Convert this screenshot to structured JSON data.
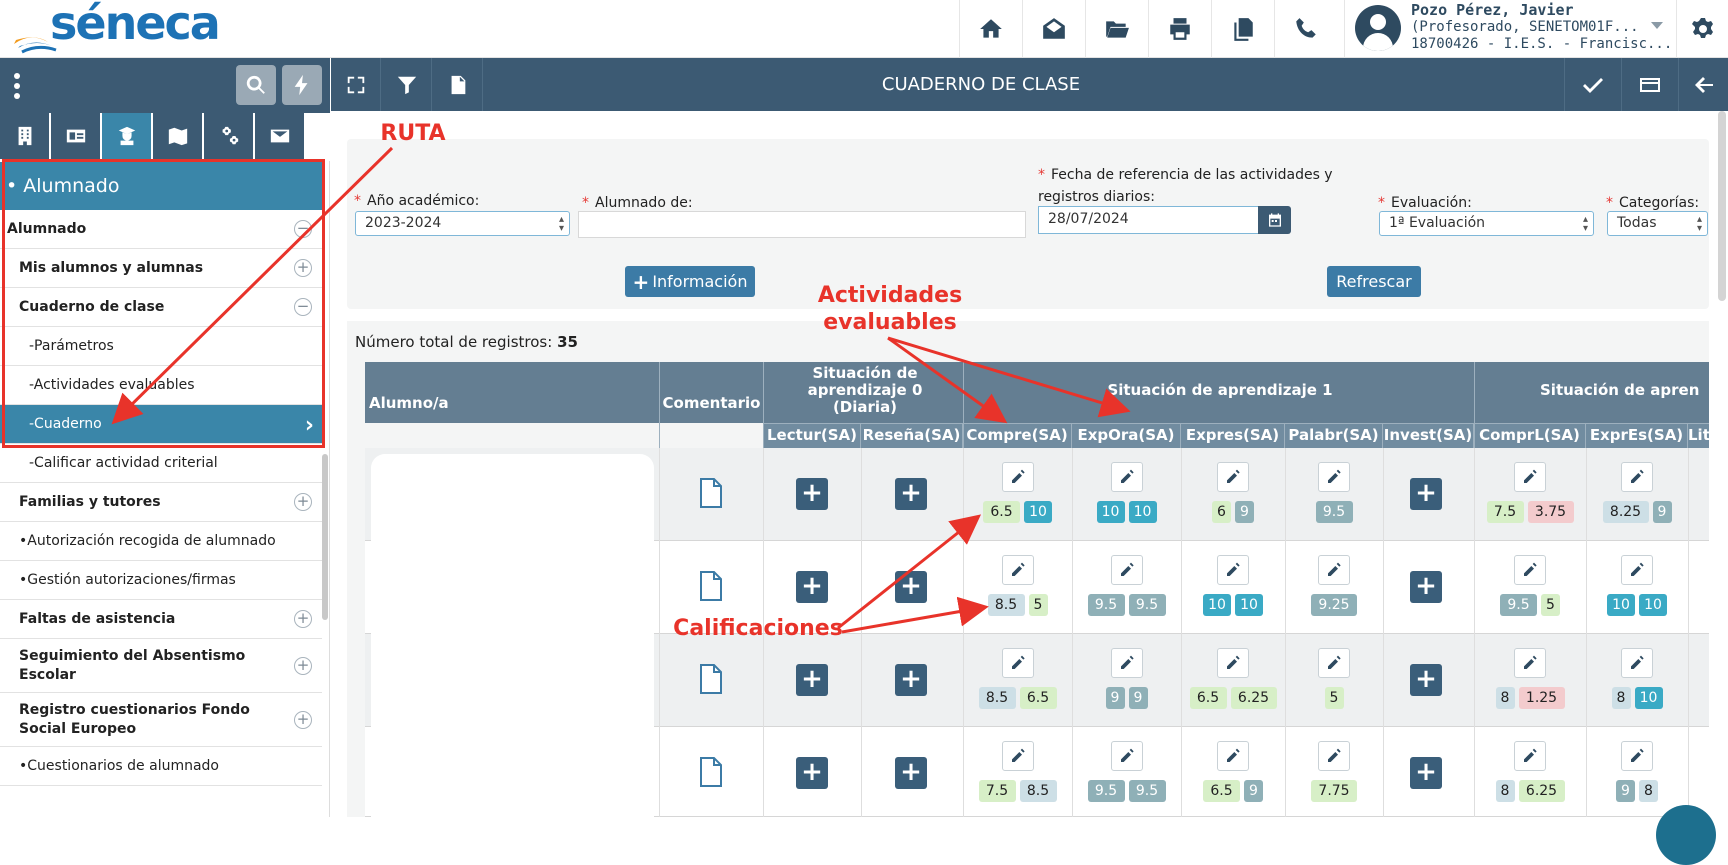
{
  "app": {
    "logo_text": "séneca"
  },
  "topbar": {
    "icons": [
      "home-icon",
      "mail-icon",
      "folder-icon",
      "print-icon",
      "documents-icon",
      "phone-icon"
    ],
    "user": {
      "name": "Pozo Pérez, Javier",
      "role": "(Profesorado, SENETOM01F...",
      "center": "18700426 - I.E.S. - Francisc..."
    }
  },
  "sidebar": {
    "header": "• Alumnado",
    "items": [
      {
        "label": "Alumnado",
        "level": 0,
        "bold": true,
        "control": "−"
      },
      {
        "label": "Mis alumnos y alumnas",
        "level": 1,
        "bold": true,
        "control": "+"
      },
      {
        "label": "Cuaderno de clase",
        "level": 1,
        "bold": true,
        "control": "−"
      },
      {
        "label": "-Parámetros",
        "level": 2
      },
      {
        "label": "-Actividades evaluables",
        "level": 2
      },
      {
        "label": "-Cuaderno",
        "level": 2,
        "selected": true
      },
      {
        "label": "-Calificar actividad criterial",
        "level": 2
      },
      {
        "label": "Familias y tutores",
        "level": 1,
        "bold": true,
        "control": "+"
      },
      {
        "label": "•Autorización recogida de alumnado",
        "level": 1
      },
      {
        "label": "•Gestión autorizaciones/firmas",
        "level": 1
      },
      {
        "label": "Faltas de asistencia",
        "level": 1,
        "bold": true,
        "control": "+"
      },
      {
        "label": "Seguimiento del Absentismo Escolar",
        "level": 1,
        "bold": true,
        "control": "+",
        "tall": true
      },
      {
        "label": "Registro cuestionarios Fondo Social Europeo",
        "level": 1,
        "bold": true,
        "control": "+",
        "tall": true
      },
      {
        "label": "•Cuestionarios de alumnado",
        "level": 1
      }
    ]
  },
  "main": {
    "title": "CUADERNO DE CLASE",
    "form": {
      "anio_label": "Año académico:",
      "anio_value": "2023-2024",
      "alumnado_label": "Alumnado de:",
      "alumnado_value": "",
      "fecha_label_1": "Fecha de referencia de las actividades y",
      "fecha_label_2": "registros diarios:",
      "fecha_value": "28/07/2024",
      "evaluacion_label": "Evaluación:",
      "evaluacion_value": "1ª Evaluación",
      "categorias_label": "Categorías:",
      "categorias_value": "Todas",
      "info_button": "Información",
      "refresh_button": "Refrescar"
    },
    "total_label": "Número total de registros:",
    "total_value": "35",
    "table": {
      "col_alumno": "Alumno/a",
      "col_comentario": "Comentario",
      "group_sa0": "Situación de aprendizaje 0 (Diaria)",
      "group_sa1": "Situación de aprendizaje 1",
      "group_sa2": "Situación de apren",
      "sub_cols": [
        "Lectur(SA)",
        "Reseña(SA)",
        "Compre(SA)",
        "ExpOra(SA)",
        "Expres(SA)",
        "Palabr(SA)",
        "Invest(SA)",
        "ComprL(SA)",
        "ExprEs(SA)",
        "Lit"
      ],
      "rows": [
        {
          "compre": [
            "6.5",
            "10"
          ],
          "expora": [
            "10",
            "10"
          ],
          "expres": [
            "6",
            "9"
          ],
          "palabr": [
            "9.5"
          ],
          "comprl": [
            "7.5",
            "3.75"
          ],
          "expres2": [
            "8.25",
            "9"
          ]
        },
        {
          "compre": [
            "8.5",
            "5"
          ],
          "expora": [
            "9.5",
            "9.5"
          ],
          "expres": [
            "10",
            "10"
          ],
          "palabr": [
            "9.25"
          ],
          "comprl": [
            "9.5",
            "5"
          ],
          "expres2": [
            "10",
            "10"
          ]
        },
        {
          "compre": [
            "8.5",
            "6.5"
          ],
          "expora": [
            "9",
            "9"
          ],
          "expres": [
            "6.5",
            "6.25"
          ],
          "palabr": [
            "5"
          ],
          "comprl": [
            "8",
            "1.25"
          ],
          "expres2": [
            "8",
            "10"
          ]
        },
        {
          "compre": [
            "7.5",
            "8.5"
          ],
          "expora": [
            "9.5",
            "9.5"
          ],
          "expres": [
            "6.5",
            "9"
          ],
          "palabr": [
            "7.75"
          ],
          "comprl": [
            "8",
            "6.25"
          ],
          "expres2": [
            "9",
            "8"
          ]
        }
      ]
    }
  },
  "annotations": {
    "ruta": "RUTA",
    "actividades_1": "Actividades",
    "actividades_2": "evaluables",
    "calificaciones": "Calificaciones"
  }
}
